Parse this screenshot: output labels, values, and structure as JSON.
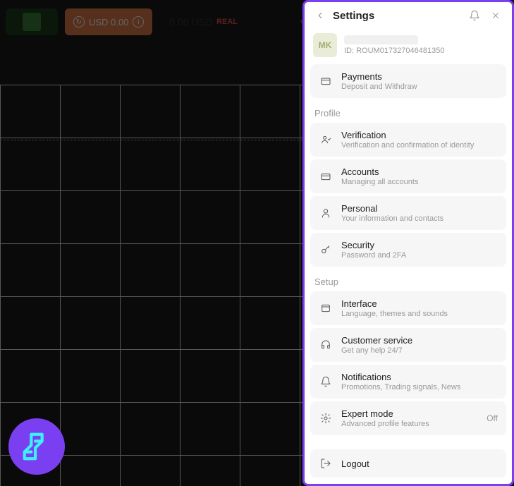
{
  "topbar": {
    "usd_button": "USD 0.00",
    "balance": "0.00 USD",
    "balance_badge": "REAL"
  },
  "panel": {
    "title": "Settings",
    "user": {
      "avatar": "MK",
      "id": "ID: ROUM017327046481350"
    },
    "payments": {
      "title": "Payments",
      "sub": "Deposit and Withdraw"
    },
    "section_profile": "Profile",
    "verification": {
      "title": "Verification",
      "sub": "Verification and confirmation of identity"
    },
    "accounts": {
      "title": "Accounts",
      "sub": "Managing all accounts"
    },
    "personal": {
      "title": "Personal",
      "sub": "Your information and contacts"
    },
    "security": {
      "title": "Security",
      "sub": "Password and 2FA"
    },
    "section_setup": "Setup",
    "interface": {
      "title": "Interface",
      "sub": "Language, themes and sounds"
    },
    "customer_service": {
      "title": "Customer service",
      "sub": "Get any help 24/7"
    },
    "notifications": {
      "title": "Notifications",
      "sub": "Promotions, Trading signals, News"
    },
    "expert_mode": {
      "title": "Expert mode",
      "sub": "Advanced profile features",
      "state": "Off"
    },
    "logout": "Logout"
  }
}
